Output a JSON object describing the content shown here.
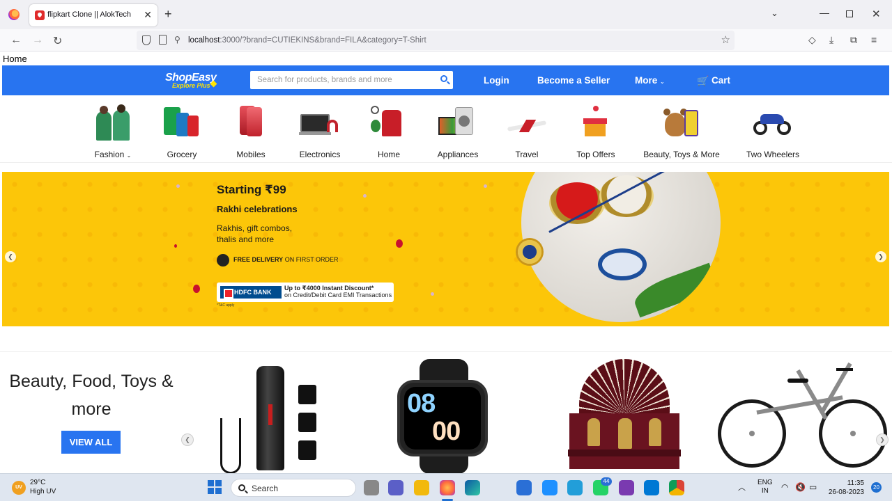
{
  "browser": {
    "tab": {
      "title": "flipkart Clone || AlokTech"
    },
    "url": {
      "host": "localhost",
      "path": ":3000/?brand=CUTIEKINS&brand=FILA&category=T-Shirt"
    }
  },
  "page": {
    "home_link": "Home",
    "header": {
      "logo": {
        "name": "ShopEasy",
        "tagline": "Explore Plus"
      },
      "search": {
        "placeholder": "Search for products, brands and more"
      },
      "login": "Login",
      "seller": "Become a Seller",
      "more": "More",
      "cart": "Cart"
    },
    "categories": [
      {
        "label": "Fashion",
        "has_dropdown": true
      },
      {
        "label": "Grocery"
      },
      {
        "label": "Mobiles"
      },
      {
        "label": "Electronics"
      },
      {
        "label": "Home"
      },
      {
        "label": "Appliances"
      },
      {
        "label": "Travel"
      },
      {
        "label": "Top Offers"
      },
      {
        "label": "Beauty, Toys & More"
      },
      {
        "label": "Two Wheelers"
      }
    ],
    "banner": {
      "title": "Starting ₹99",
      "subtitle": "Rakhi celebrations",
      "desc_line1": "Rakhis, gift combos,",
      "desc_line2": "thalis and more",
      "delivery_bold": "FREE DELIVERY",
      "delivery_rest": "ON FIRST ORDER",
      "bank": "HDFC BANK",
      "offer_line1": "Up to ₹4000 Instant Discount*",
      "offer_line2": "on Credit/Debit Card EMI Transactions",
      "tc": "*T&C apply",
      "color": "#fcc609"
    },
    "section": {
      "title": "Beauty, Food, Toys & more",
      "view_all": "VIEW ALL",
      "watch_hour": "08",
      "watch_min": "00"
    },
    "accent_color": "#2874f0"
  },
  "taskbar": {
    "weather": {
      "badge": "UV",
      "temp": "29°C",
      "desc": "High UV"
    },
    "search": "Search",
    "whatsapp_badge": "44",
    "lang_line1": "ENG",
    "lang_line2": "IN",
    "time": "11:35",
    "date": "26-08-2023",
    "notifications": "20"
  }
}
